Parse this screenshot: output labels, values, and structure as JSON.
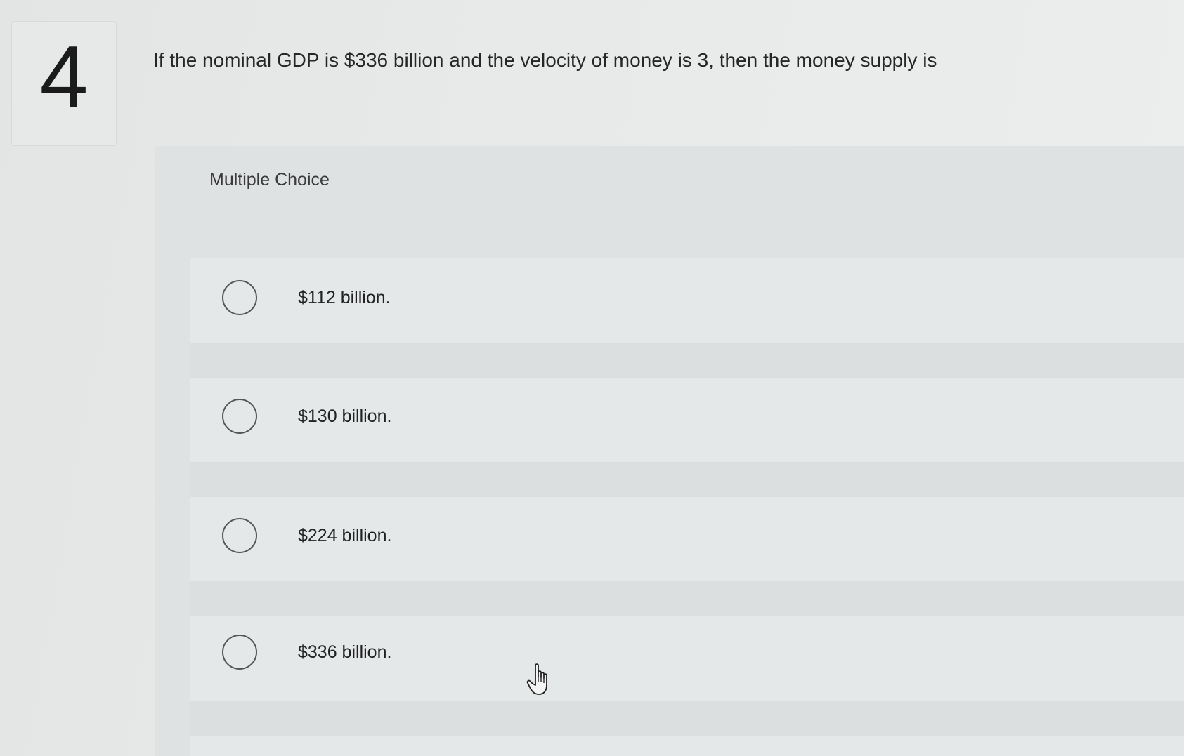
{
  "question": {
    "number": "4",
    "text": "If the nominal GDP is $336 billion and the velocity of money is 3, then the money supply is"
  },
  "choices": {
    "heading": "Multiple Choice",
    "options": [
      {
        "label": "$112 billion.",
        "selected": false
      },
      {
        "label": "$130 billion.",
        "selected": false
      },
      {
        "label": "$224 billion.",
        "selected": false
      },
      {
        "label": "$336 billion.",
        "selected": false
      }
    ]
  },
  "cursor": {
    "icon": "hand-pointer-icon"
  }
}
